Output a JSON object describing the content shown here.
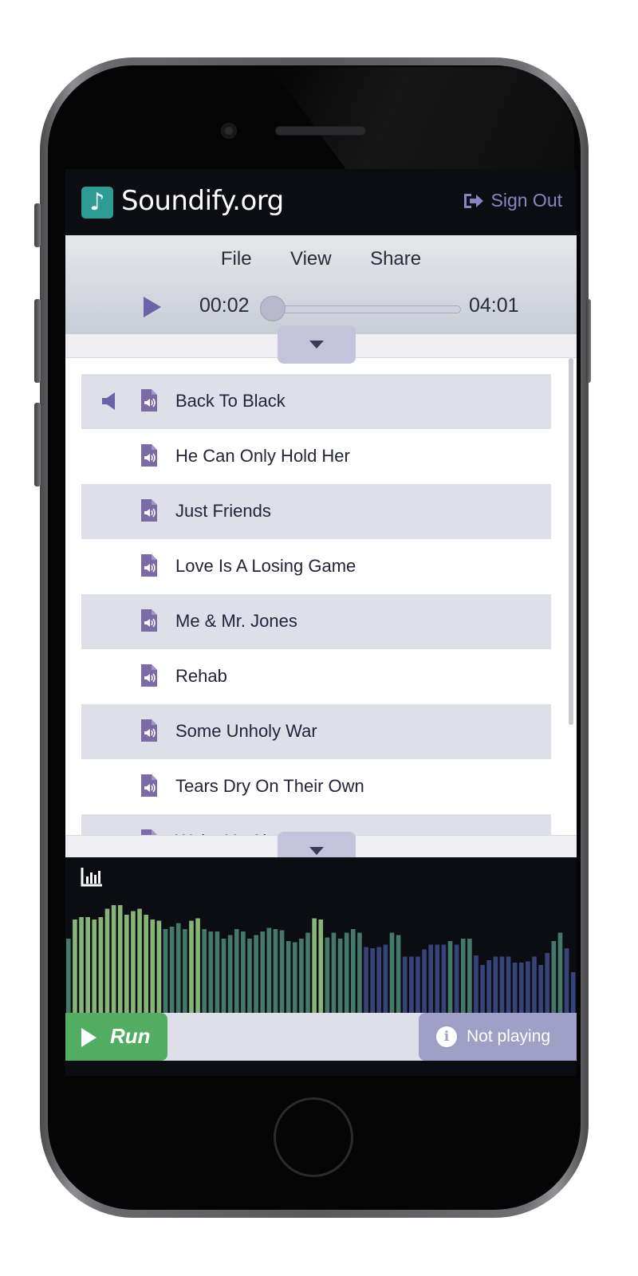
{
  "app": {
    "title": "Soundify.org",
    "logo_glyph": "♪",
    "signout_label": "Sign Out"
  },
  "menu": [
    "File",
    "View",
    "Share"
  ],
  "player": {
    "current_time": "00:02",
    "total_time": "04:01",
    "progress": 0.0
  },
  "playlist": [
    {
      "title": "Back To Black",
      "playing": true
    },
    {
      "title": "He Can Only Hold Her",
      "playing": false
    },
    {
      "title": "Just Friends",
      "playing": false
    },
    {
      "title": "Love Is A Losing Game",
      "playing": false
    },
    {
      "title": "Me & Mr. Jones",
      "playing": false
    },
    {
      "title": "Rehab",
      "playing": false
    },
    {
      "title": "Some Unholy War",
      "playing": false
    },
    {
      "title": "Tears Dry On Their Own",
      "playing": false
    },
    {
      "title": "Wake Up Alone",
      "playing": false
    }
  ],
  "visualizer": {
    "levels": [
      0.62,
      0.78,
      0.8,
      0.8,
      0.78,
      0.8,
      0.87,
      0.9,
      0.9,
      0.82,
      0.85,
      0.87,
      0.82,
      0.78,
      0.77,
      0.7,
      0.72,
      0.75,
      0.7,
      0.77,
      0.79,
      0.7,
      0.68,
      0.68,
      0.62,
      0.65,
      0.7,
      0.68,
      0.62,
      0.65,
      0.68,
      0.71,
      0.7,
      0.69,
      0.6,
      0.59,
      0.62,
      0.67,
      0.79,
      0.78,
      0.63,
      0.67,
      0.62,
      0.67,
      0.7,
      0.67,
      0.55,
      0.54,
      0.55,
      0.57,
      0.67,
      0.65,
      0.47,
      0.47,
      0.47,
      0.53,
      0.57,
      0.57,
      0.57,
      0.6,
      0.57,
      0.62,
      0.62,
      0.48,
      0.4,
      0.44,
      0.47,
      0.47,
      0.47,
      0.42,
      0.42,
      0.43,
      0.47,
      0.4,
      0.5,
      0.6,
      0.67,
      0.54,
      0.34
    ],
    "colors": {
      "low": "#3f4f8c",
      "mid": "#4f8d7a",
      "high": "#9dd48a"
    }
  },
  "footer": {
    "run_label": "Run",
    "status_label": "Not playing"
  },
  "colors": {
    "accent": "#7b6aa6",
    "teal": "#2e9b95",
    "run_green": "#52ad63",
    "status_purple": "#a09fc6"
  }
}
